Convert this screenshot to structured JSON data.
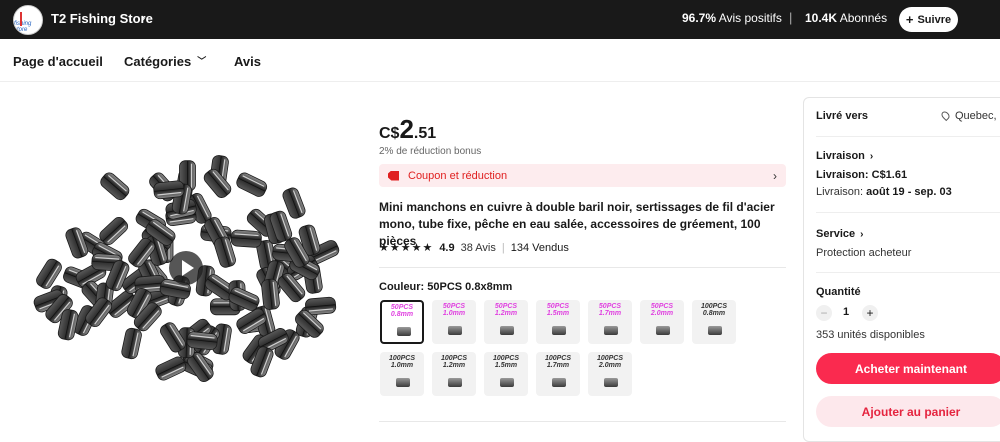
{
  "store": {
    "logo_text": "fishing store",
    "name": "T2 Fishing Store",
    "positive_pct": "96.7%",
    "positive_label": "Avis positifs",
    "followers": "10.4K",
    "followers_label": "Abonnés",
    "follow_label": "Suivre"
  },
  "nav": {
    "home": "Page d'accueil",
    "categories": "Catégories",
    "reviews": "Avis"
  },
  "product": {
    "currency": "C$",
    "price_int": "2",
    "price_dec": ".51",
    "bonus": "2% de réduction bonus",
    "coupon_label": "Coupon et réduction",
    "title": "Mini manchons en cuivre à double baril noir, sertissages de fil d'acier mono, tube fixe, pêche en eau salée, accessoires de gréement, 100 pièces",
    "rating": "4.9",
    "stars": "★★★★★",
    "reviews": "38 Avis",
    "sold": "134 Vendus",
    "color_label": "Couleur: 50PCS 0.8x8mm",
    "variants": [
      {
        "line1": "50PCS",
        "line2": "0.8mm",
        "color": "#e040e0",
        "selected": true
      },
      {
        "line1": "50PCS",
        "line2": "1.0mm",
        "color": "#e040e0"
      },
      {
        "line1": "50PCS",
        "line2": "1.2mm",
        "color": "#e040e0"
      },
      {
        "line1": "50PCS",
        "line2": "1.5mm",
        "color": "#e040e0"
      },
      {
        "line1": "50PCS",
        "line2": "1.7mm",
        "color": "#e040e0"
      },
      {
        "line1": "50PCS",
        "line2": "2.0mm",
        "color": "#e040e0"
      },
      {
        "line1": "100PCS",
        "line2": "0.8mm",
        "color": "#333333"
      },
      {
        "line1": "100PCS",
        "line2": "1.0mm",
        "color": "#333333"
      },
      {
        "line1": "100PCS",
        "line2": "1.2mm",
        "color": "#333333"
      },
      {
        "line1": "100PCS",
        "line2": "1.5mm",
        "color": "#333333"
      },
      {
        "line1": "100PCS",
        "line2": "1.7mm",
        "color": "#333333"
      },
      {
        "line1": "100PCS",
        "line2": "2.0mm",
        "color": "#333333"
      }
    ]
  },
  "panel": {
    "ship_to_label": "Livré vers",
    "ship_to_value": "Quebec, C",
    "delivery_label": "Livraison",
    "delivery_cost": "Livraison: C$1.61",
    "delivery_date_prefix": "Livraison:",
    "delivery_date": "août 19 - sep. 03",
    "service_label": "Service",
    "service_value": "Protection acheteur",
    "qty_label": "Quantité",
    "qty_value": "1",
    "stock": "353 unités disponibles",
    "buy_label": "Acheter maintenant",
    "cart_label": "Ajouter au panier"
  },
  "colors": {
    "accent": "#fa2a4f",
    "topbar": "#191919",
    "coupon_bg": "#fdecee"
  }
}
